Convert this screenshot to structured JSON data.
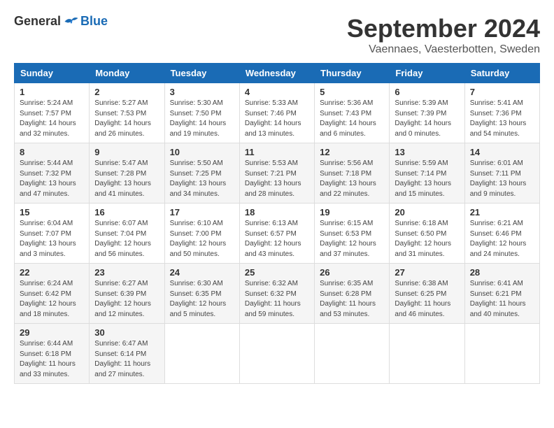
{
  "header": {
    "logo_general": "General",
    "logo_blue": "Blue",
    "title": "September 2024",
    "location": "Vaennaes, Vaesterbotten, Sweden"
  },
  "weekdays": [
    "Sunday",
    "Monday",
    "Tuesday",
    "Wednesday",
    "Thursday",
    "Friday",
    "Saturday"
  ],
  "weeks": [
    [
      {
        "day": "1",
        "sunrise": "5:24 AM",
        "sunset": "7:57 PM",
        "daylight": "14 hours and 32 minutes."
      },
      {
        "day": "2",
        "sunrise": "5:27 AM",
        "sunset": "7:53 PM",
        "daylight": "14 hours and 26 minutes."
      },
      {
        "day": "3",
        "sunrise": "5:30 AM",
        "sunset": "7:50 PM",
        "daylight": "14 hours and 19 minutes."
      },
      {
        "day": "4",
        "sunrise": "5:33 AM",
        "sunset": "7:46 PM",
        "daylight": "14 hours and 13 minutes."
      },
      {
        "day": "5",
        "sunrise": "5:36 AM",
        "sunset": "7:43 PM",
        "daylight": "14 hours and 6 minutes."
      },
      {
        "day": "6",
        "sunrise": "5:39 AM",
        "sunset": "7:39 PM",
        "daylight": "14 hours and 0 minutes."
      },
      {
        "day": "7",
        "sunrise": "5:41 AM",
        "sunset": "7:36 PM",
        "daylight": "13 hours and 54 minutes."
      }
    ],
    [
      {
        "day": "8",
        "sunrise": "5:44 AM",
        "sunset": "7:32 PM",
        "daylight": "13 hours and 47 minutes."
      },
      {
        "day": "9",
        "sunrise": "5:47 AM",
        "sunset": "7:28 PM",
        "daylight": "13 hours and 41 minutes."
      },
      {
        "day": "10",
        "sunrise": "5:50 AM",
        "sunset": "7:25 PM",
        "daylight": "13 hours and 34 minutes."
      },
      {
        "day": "11",
        "sunrise": "5:53 AM",
        "sunset": "7:21 PM",
        "daylight": "13 hours and 28 minutes."
      },
      {
        "day": "12",
        "sunrise": "5:56 AM",
        "sunset": "7:18 PM",
        "daylight": "13 hours and 22 minutes."
      },
      {
        "day": "13",
        "sunrise": "5:59 AM",
        "sunset": "7:14 PM",
        "daylight": "13 hours and 15 minutes."
      },
      {
        "day": "14",
        "sunrise": "6:01 AM",
        "sunset": "7:11 PM",
        "daylight": "13 hours and 9 minutes."
      }
    ],
    [
      {
        "day": "15",
        "sunrise": "6:04 AM",
        "sunset": "7:07 PM",
        "daylight": "13 hours and 3 minutes."
      },
      {
        "day": "16",
        "sunrise": "6:07 AM",
        "sunset": "7:04 PM",
        "daylight": "12 hours and 56 minutes."
      },
      {
        "day": "17",
        "sunrise": "6:10 AM",
        "sunset": "7:00 PM",
        "daylight": "12 hours and 50 minutes."
      },
      {
        "day": "18",
        "sunrise": "6:13 AM",
        "sunset": "6:57 PM",
        "daylight": "12 hours and 43 minutes."
      },
      {
        "day": "19",
        "sunrise": "6:15 AM",
        "sunset": "6:53 PM",
        "daylight": "12 hours and 37 minutes."
      },
      {
        "day": "20",
        "sunrise": "6:18 AM",
        "sunset": "6:50 PM",
        "daylight": "12 hours and 31 minutes."
      },
      {
        "day": "21",
        "sunrise": "6:21 AM",
        "sunset": "6:46 PM",
        "daylight": "12 hours and 24 minutes."
      }
    ],
    [
      {
        "day": "22",
        "sunrise": "6:24 AM",
        "sunset": "6:42 PM",
        "daylight": "12 hours and 18 minutes."
      },
      {
        "day": "23",
        "sunrise": "6:27 AM",
        "sunset": "6:39 PM",
        "daylight": "12 hours and 12 minutes."
      },
      {
        "day": "24",
        "sunrise": "6:30 AM",
        "sunset": "6:35 PM",
        "daylight": "12 hours and 5 minutes."
      },
      {
        "day": "25",
        "sunrise": "6:32 AM",
        "sunset": "6:32 PM",
        "daylight": "11 hours and 59 minutes."
      },
      {
        "day": "26",
        "sunrise": "6:35 AM",
        "sunset": "6:28 PM",
        "daylight": "11 hours and 53 minutes."
      },
      {
        "day": "27",
        "sunrise": "6:38 AM",
        "sunset": "6:25 PM",
        "daylight": "11 hours and 46 minutes."
      },
      {
        "day": "28",
        "sunrise": "6:41 AM",
        "sunset": "6:21 PM",
        "daylight": "11 hours and 40 minutes."
      }
    ],
    [
      {
        "day": "29",
        "sunrise": "6:44 AM",
        "sunset": "6:18 PM",
        "daylight": "11 hours and 33 minutes."
      },
      {
        "day": "30",
        "sunrise": "6:47 AM",
        "sunset": "6:14 PM",
        "daylight": "11 hours and 27 minutes."
      },
      null,
      null,
      null,
      null,
      null
    ]
  ]
}
